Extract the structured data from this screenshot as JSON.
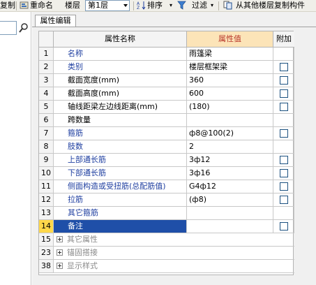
{
  "toolbar": {
    "copy_label": "复制",
    "rename_label": "重命名",
    "floor_label": "楼层",
    "floor_value": "第1层",
    "sort_label": "排序",
    "filter_label": "过滤",
    "copy_from_label": "从其他楼层复制构件"
  },
  "tab": {
    "label": "属性编辑"
  },
  "grid": {
    "headers": {
      "name": "属性名称",
      "value": "属性值",
      "add": "附加"
    },
    "rows": [
      {
        "num": "1",
        "name": "名称",
        "value": "雨篷梁",
        "color": "blue",
        "checkbox": false,
        "selected": false
      },
      {
        "num": "2",
        "name": "类别",
        "value": "楼层框架梁",
        "color": "blue",
        "checkbox": true,
        "selected": false
      },
      {
        "num": "3",
        "name": "截面宽度(mm)",
        "value": "360",
        "color": "black",
        "checkbox": true,
        "selected": false
      },
      {
        "num": "4",
        "name": "截面高度(mm)",
        "value": "600",
        "color": "black",
        "checkbox": true,
        "selected": false
      },
      {
        "num": "5",
        "name": "轴线距梁左边线距离(mm)",
        "value": "(180)",
        "color": "black",
        "checkbox": true,
        "selected": false
      },
      {
        "num": "6",
        "name": "跨数量",
        "value": "",
        "color": "black",
        "checkbox": false,
        "selected": false
      },
      {
        "num": "7",
        "name": "箍筋",
        "value": "ф8@100(2)",
        "color": "blue",
        "checkbox": true,
        "selected": false
      },
      {
        "num": "8",
        "name": "肢数",
        "value": "2",
        "color": "blue",
        "checkbox": false,
        "selected": false
      },
      {
        "num": "9",
        "name": "上部通长筋",
        "value": "3ф12",
        "color": "blue",
        "checkbox": true,
        "selected": false
      },
      {
        "num": "10",
        "name": "下部通长筋",
        "value": "3ф16",
        "color": "blue",
        "checkbox": true,
        "selected": false
      },
      {
        "num": "11",
        "name": "侧面构造或受扭筋(总配筋值)",
        "value": "G4ф12",
        "color": "blue",
        "checkbox": true,
        "selected": false
      },
      {
        "num": "12",
        "name": "拉筋",
        "value": "(ф8)",
        "color": "blue",
        "checkbox": true,
        "selected": false
      },
      {
        "num": "13",
        "name": "其它箍筋",
        "value": "",
        "color": "blue",
        "checkbox": false,
        "selected": false
      },
      {
        "num": "14",
        "name": "备注",
        "value": "",
        "color": "blue",
        "checkbox": true,
        "selected": true
      }
    ],
    "groups": [
      {
        "num": "15",
        "name": "其它属性"
      },
      {
        "num": "23",
        "name": "锚固搭接"
      },
      {
        "num": "38",
        "name": "显示样式"
      }
    ]
  },
  "colors": {
    "header_value_bg": "#fce4b8",
    "header_value_text": "#b8352a",
    "label_blue": "#1f3fa0",
    "selection": "#1f4fa8",
    "selected_row_number": "#ffd84a"
  },
  "icons": [
    "rename-icon",
    "sort-icon",
    "filter-icon",
    "copy-floor-icon",
    "search-icon",
    "checkbox",
    "expand-icon"
  ]
}
